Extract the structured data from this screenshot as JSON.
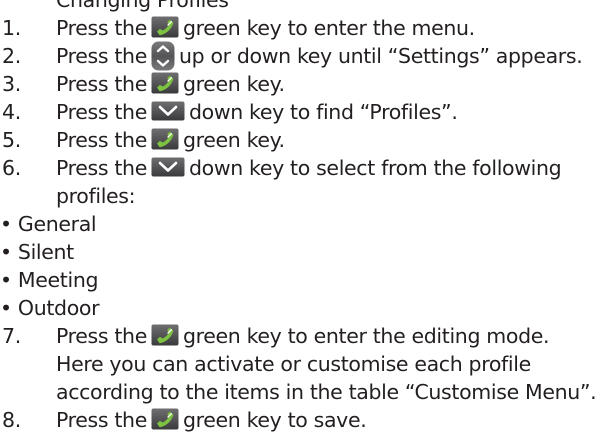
{
  "intro": "Changing Profiles",
  "steps": [
    {
      "number": "1.",
      "before": "Press the",
      "icon": "green-call-key-icon",
      "after": "green key to enter the menu."
    },
    {
      "number": "2.",
      "before": "Press the",
      "icon": "up-down-navigation-key-icon",
      "after": "up or down key until “Settings” appears."
    },
    {
      "number": "3.",
      "before": "Press the",
      "icon": "green-call-key-icon",
      "after": "green key."
    },
    {
      "number": "4.",
      "before": "Press the",
      "icon": "down-key-icon",
      "after": "down key to find “Profiles”."
    },
    {
      "number": "5.",
      "before": "Press the",
      "icon": "green-call-key-icon",
      "after": "green key."
    },
    {
      "number": "6.",
      "before": "Press the",
      "icon": "down-key-icon",
      "after": "down key to select from the following",
      "continuation": [
        "profiles:"
      ]
    },
    {
      "number": "7.",
      "before": "Press the",
      "icon": "green-call-key-icon",
      "after": "green key to enter the editing mode.",
      "continuation": [
        "Here you can activate or customise each profile",
        "according to the items in the table “Customise Menu”."
      ]
    },
    {
      "number": "8.",
      "before": "Press the",
      "icon": "green-call-key-icon",
      "after": "green key to save."
    }
  ],
  "profiles": [
    {
      "bullet": "•",
      "label": "General"
    },
    {
      "bullet": "•",
      "label": "Silent"
    },
    {
      "bullet": "•",
      "label": "Meeting"
    },
    {
      "bullet": "•",
      "label": "Outdoor"
    }
  ],
  "colors": {
    "text": "#231f20",
    "green_key": "#7dc242",
    "key_dark": "#4d4d4f"
  }
}
